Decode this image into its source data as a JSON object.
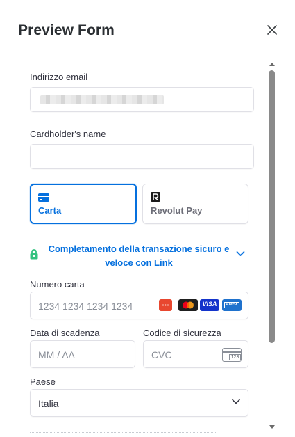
{
  "header": {
    "title": "Preview Form",
    "close_icon": "close-icon"
  },
  "email": {
    "label": "Indirizzo email",
    "value_redacted": true
  },
  "cardholder": {
    "label": "Cardholder's name",
    "value": ""
  },
  "payment_tabs": [
    {
      "label": "Carta",
      "icon": "credit-card-icon",
      "selected": true
    },
    {
      "label": "Revolut Pay",
      "icon": "revolut-logo-icon",
      "selected": false
    }
  ],
  "link": {
    "line1": "Completamento della transazione sicuro e",
    "line2": "veloce con Link",
    "icon": "lock-icon",
    "expand_icon": "chevron-down-icon"
  },
  "card_number": {
    "label": "Numero carta",
    "placeholder": "1234 1234 1234 1234",
    "brands": [
      "card-red",
      "mastercard",
      "visa",
      "amex"
    ],
    "visa_text": "VISA",
    "amex_text": "AMEX"
  },
  "expiry": {
    "label": "Data di scadenza",
    "placeholder": "MM / AA"
  },
  "cvc": {
    "label": "Codice di sicurezza",
    "placeholder": "CVC",
    "icon_text": "123"
  },
  "country": {
    "label": "Paese",
    "value": "Italia"
  },
  "colors": {
    "accent": "#0570de",
    "link_lock": "#33c27f",
    "text": "#30313d",
    "placeholder": "#8a8f98",
    "border": "#e0e0e6"
  }
}
